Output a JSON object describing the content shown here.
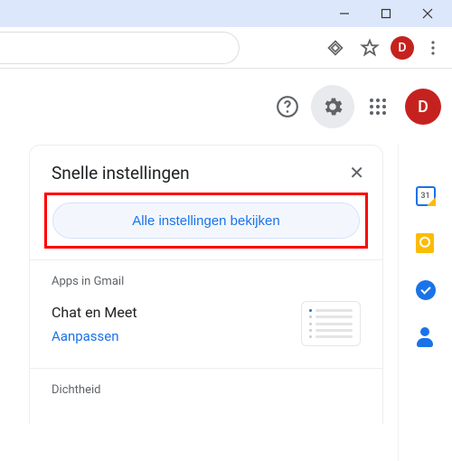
{
  "avatar_letter": "D",
  "panel": {
    "title": "Snelle instellingen",
    "all_settings": "Alle instellingen bekijken",
    "section_apps": {
      "label": "Apps in Gmail",
      "row": "Chat en Meet",
      "link": "Aanpassen"
    },
    "section_density": {
      "label": "Dichtheid"
    }
  }
}
